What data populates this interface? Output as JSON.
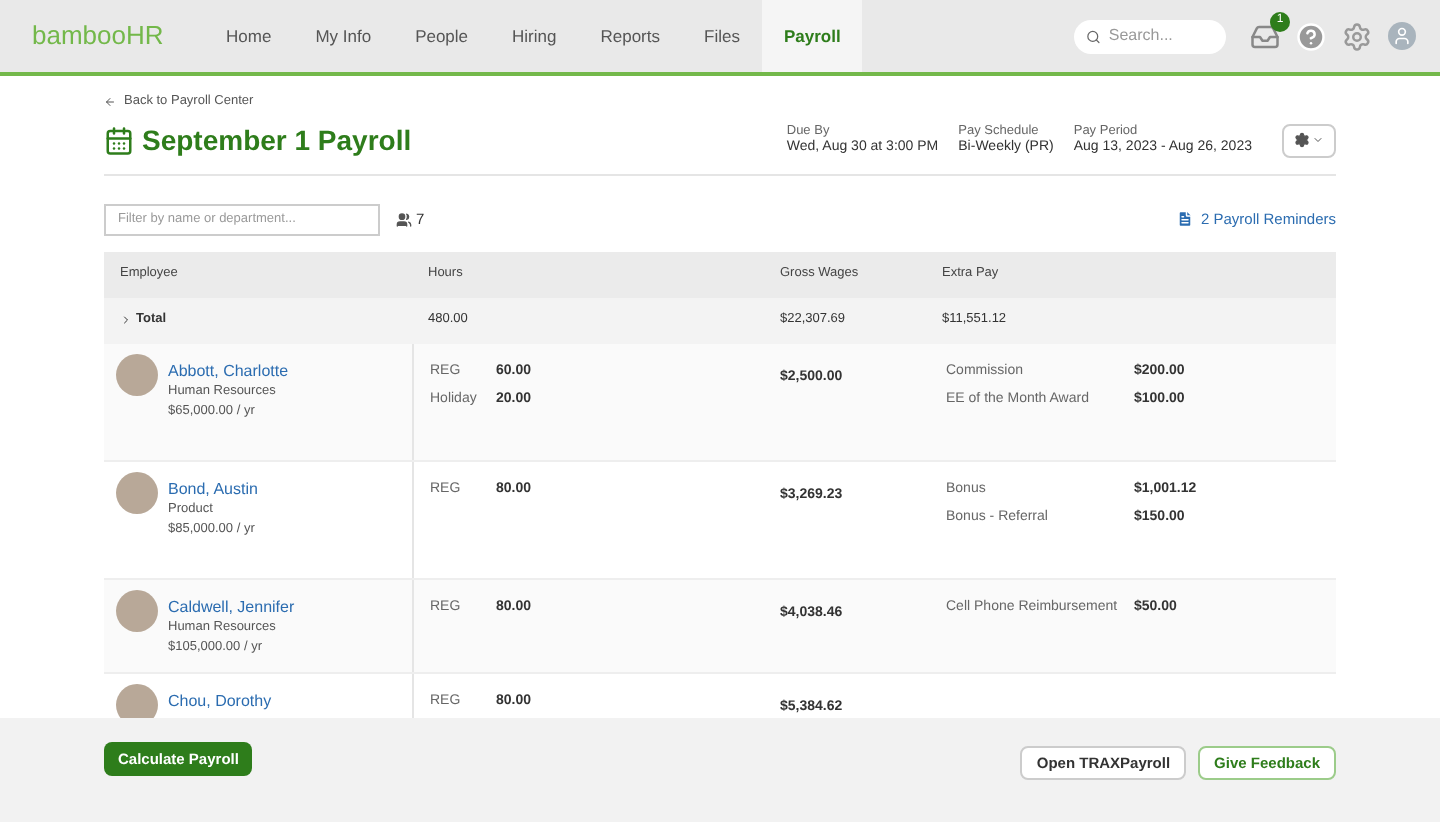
{
  "nav": {
    "logo": "bambooHR",
    "items": [
      {
        "label": "Home",
        "selected": false
      },
      {
        "label": "My Info",
        "selected": false
      },
      {
        "label": "People",
        "selected": false
      },
      {
        "label": "Hiring",
        "selected": false
      },
      {
        "label": "Reports",
        "selected": false
      },
      {
        "label": "Files",
        "selected": false
      },
      {
        "label": "Payroll",
        "selected": true
      }
    ],
    "search": {
      "placeholder": "Search..."
    },
    "inbox_badge": "1"
  },
  "header": {
    "back_link": "Back to Payroll Center",
    "title": "September 1 Payroll",
    "meta": [
      {
        "label": "Due By",
        "value": "Wed, Aug 30 at 3:00 PM"
      },
      {
        "label": "Pay Schedule",
        "value": "Bi-Weekly (PR)"
      },
      {
        "label": "Pay Period",
        "value": "Aug 13, 2023 - Aug 26, 2023"
      }
    ]
  },
  "toolbar": {
    "filter": {
      "placeholder": "Filter by name or department..."
    },
    "people_count": "7",
    "reminders": "2 Payroll Reminders"
  },
  "table": {
    "columns": [
      "Employee",
      "Hours",
      "Gross Wages",
      "Extra Pay"
    ],
    "total": {
      "label": "Total",
      "hours": "480.00",
      "gross": "$22,307.69",
      "extra": "$11,551.12"
    },
    "rows": [
      {
        "name": "Abbott, Charlotte",
        "department": "Human Resources",
        "salary": "$65,000.00 / yr",
        "hours": [
          {
            "type": "REG",
            "amount": "60.00"
          },
          {
            "type": "Holiday",
            "amount": "20.00"
          }
        ],
        "gross": "$2,500.00",
        "extras": [
          {
            "label": "Commission",
            "amount": "$200.00"
          },
          {
            "label": "EE of the Month Award",
            "amount": "$100.00"
          }
        ]
      },
      {
        "name": "Bond, Austin",
        "department": "Product",
        "salary": "$85,000.00 / yr",
        "hours": [
          {
            "type": "REG",
            "amount": "80.00"
          }
        ],
        "gross": "$3,269.23",
        "extras": [
          {
            "label": "Bonus",
            "amount": "$1,001.12"
          },
          {
            "label": "Bonus - Referral",
            "amount": "$150.00"
          }
        ]
      },
      {
        "name": "Caldwell, Jennifer",
        "department": "Human Resources",
        "salary": "$105,000.00 / yr",
        "hours": [
          {
            "type": "REG",
            "amount": "80.00"
          }
        ],
        "gross": "$4,038.46",
        "extras": [
          {
            "label": "Cell Phone Reimbursement",
            "amount": "$50.00"
          }
        ]
      },
      {
        "name": "Chou, Dorothy",
        "hours": [
          {
            "type": "REG",
            "amount": "80.00"
          }
        ],
        "gross": "$5,384.62",
        "extras": []
      }
    ]
  },
  "footer": {
    "primary": "Calculate Payroll",
    "buttons": [
      "Open TRAXPayroll",
      "Give Feedback"
    ]
  }
}
